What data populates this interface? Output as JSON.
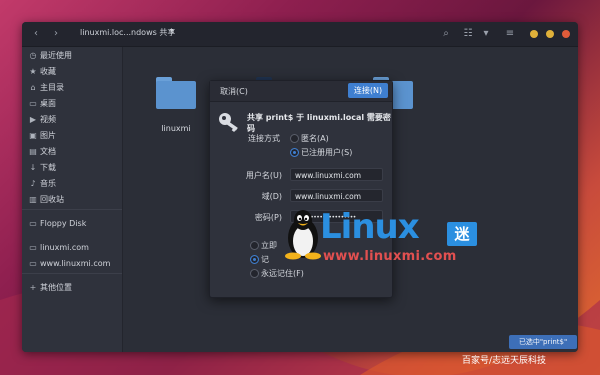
{
  "window": {
    "path": "linuxmi.loc...ndows 共享",
    "path_arrow": "▾",
    "back_icon": "‹",
    "forward_icon": "›",
    "search_icon": "⌕",
    "view_icon": "☷",
    "view_dropdown": "▾",
    "menu_icon": "≡",
    "colors": {
      "minimize": "#e0b13a",
      "maximize": "#e0b13a",
      "close": "#e05c3a"
    }
  },
  "sidebar": {
    "items": [
      {
        "icon": "clock-icon",
        "glyph": "◷",
        "label": "最近使用"
      },
      {
        "icon": "star-icon",
        "glyph": "★",
        "label": "收藏"
      },
      {
        "icon": "home-icon",
        "glyph": "⌂",
        "label": "主目录"
      },
      {
        "icon": "folder-icon",
        "glyph": "▭",
        "label": "桌面"
      },
      {
        "icon": "video-icon",
        "glyph": "▶",
        "label": "视频"
      },
      {
        "icon": "image-icon",
        "glyph": "▣",
        "label": "图片"
      },
      {
        "icon": "document-icon",
        "glyph": "▤",
        "label": "文档"
      },
      {
        "icon": "download-icon",
        "glyph": "↓",
        "label": "下载"
      },
      {
        "icon": "music-icon",
        "glyph": "♪",
        "label": "音乐"
      },
      {
        "icon": "trash-icon",
        "glyph": "▥",
        "label": "回收站"
      },
      {
        "icon": "floppy-icon",
        "glyph": "▭",
        "label": "Floppy Disk"
      },
      {
        "icon": "network-folder-icon",
        "glyph": "▭",
        "label": "linuxmi.com"
      },
      {
        "icon": "network-folder-icon",
        "glyph": "▭",
        "label": "www.linuxmi.com"
      },
      {
        "icon": "plus-icon",
        "glyph": "+",
        "label": "其他位置"
      }
    ]
  },
  "content": {
    "folders": [
      {
        "label": "linuxmi"
      },
      {
        "label": ""
      },
      {
        "label": ""
      }
    ],
    "status": "已选中\"print$\""
  },
  "dialog": {
    "cancel": "取消(C)",
    "connect": "连接(N)",
    "message": "共享 print$ 于 linuxmi.local 需要密码",
    "connect_as_label": "连接方式",
    "anonymous": "匿名(A)",
    "registered": "已注册用户(S)",
    "username_label": "用户名(U)",
    "username_value": "www.linuxmi.com",
    "domain_label": "域(D)",
    "domain_value": "www.linuxmi.com",
    "password_label": "密码(P)",
    "password_value": "••••••••••••••••••••",
    "forget_now": "立即",
    "remember_session": "记",
    "remember_forever": "永远记住(F)"
  },
  "watermark": {
    "linux": "Linux",
    "mi": "迷",
    "url": "www.linuxmi.com"
  },
  "caption": "百家号/志远天辰科技"
}
